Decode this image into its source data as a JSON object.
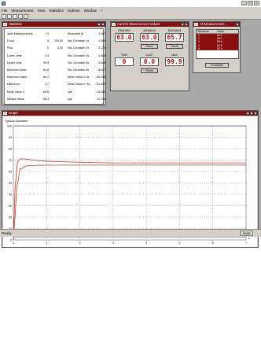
{
  "menu": [
    "File",
    "Measurement",
    "View",
    "Statistics",
    "Options",
    "Window",
    "?"
  ],
  "statistics": {
    "title": "Statistics",
    "rows": [
      {
        "label": "Valid Measurements",
        "v1": "N",
        "v2": "",
        "label2": "Measured M",
        "v3": "1'167"
      },
      {
        "label": "Good",
        "v1": "5",
        "v2": "100.00",
        "label2": "Std. Deviation 1s",
        "v3": "1.089"
      },
      {
        "label": "Poor",
        "v1": "0",
        "v2": "0.00",
        "label2": "Std. Deviation 2s",
        "v3": "2.179"
      },
      {
        "label": "Lower Limit",
        "v1": "2.5",
        "v2": "",
        "label2": "Std. Deviation 3s",
        "v3": "3.268"
      },
      {
        "label": "Upper Limit",
        "v1": "99.9",
        "v2": "",
        "label2": "Std. Deviation 4s",
        "v3": "4.358"
      },
      {
        "label": "Minimum Value",
        "v1": "62.6",
        "v2": "",
        "label2": "Std. Deviation 6s",
        "v3": "6.447"
      },
      {
        "label": "Maximum Value",
        "v1": "65.7",
        "v2": "",
        "label2": "Mean Value X-3s",
        "v3": "60.169"
      },
      {
        "label": "Difference",
        "v1": "2.7",
        "v2": "",
        "label2": "Mean Value X+3s",
        "v3": "61.632"
      },
      {
        "label": "Mean Value X",
        "v1": "64.8",
        "v2": "",
        "label2": "cpk",
        "v3": "15.282"
      },
      {
        "label": "Median Value",
        "v1": "65.3",
        "v2": "",
        "label2": "cpk",
        "v3": "10.706"
      }
    ]
  },
  "current": {
    "title": "Current Measurement Values",
    "reading_label": "READING",
    "reading": "63.0",
    "minimum_label": "MINIMUM",
    "minimum": "63.0",
    "maximum_label": "MAXIMUM",
    "maximum": "65.7",
    "reset": "Reset",
    "time_label": "TIME",
    "time": "0",
    "ldiv_label": "L/DIV",
    "ldiv": "0.0",
    "max2_label": "MAX",
    "max2": "99.9"
  },
  "all": {
    "title": "All Measurement...",
    "col1": "Measure",
    "col2": "Value",
    "rows": [
      {
        "n": "1",
        "v": "65.1"
      },
      {
        "n": "2",
        "v": "65.7"
      },
      {
        "n": "3",
        "v": "65.6"
      },
      {
        "n": "4",
        "v": "64.5"
      },
      {
        "n": "5",
        "v": "63.0"
      }
    ],
    "button": "Invalidate"
  },
  "graph": {
    "title": "Graph",
    "subtitle": "Typical Diameter"
  },
  "chart_data": {
    "type": "line",
    "title": "Typical Diameter",
    "xlabel": "s",
    "ylabel": "",
    "xlim": [
      0,
      7
    ],
    "ylim": [
      0,
      100
    ],
    "x_ticks": [
      "0",
      "1",
      "2",
      "3",
      "4",
      "5",
      "6",
      "7"
    ],
    "y_ticks": [
      "0",
      "10",
      "20",
      "30",
      "40",
      "50",
      "60",
      "70",
      "80",
      "90",
      "100"
    ],
    "grid": true,
    "series": [
      {
        "color": "#c0392b",
        "x": [
          0,
          0.05,
          0.12,
          0.2,
          0.35,
          0.6,
          1,
          2,
          3,
          4,
          5,
          6,
          7
        ],
        "y": [
          0,
          45,
          68,
          71,
          71,
          70,
          69,
          68,
          67.5,
          67.5,
          67.5,
          67.5,
          67.5
        ]
      },
      {
        "color": "#c0392b",
        "x": [
          0,
          0.05,
          0.1,
          0.2,
          0.4,
          0.8,
          2,
          7
        ],
        "y": [
          0,
          20,
          45,
          62,
          65,
          65.5,
          65.6,
          65.6
        ]
      }
    ],
    "limit_lines": [
      2.5,
      99.9
    ]
  },
  "status": {
    "left": "Ready",
    "right": "NUM"
  }
}
